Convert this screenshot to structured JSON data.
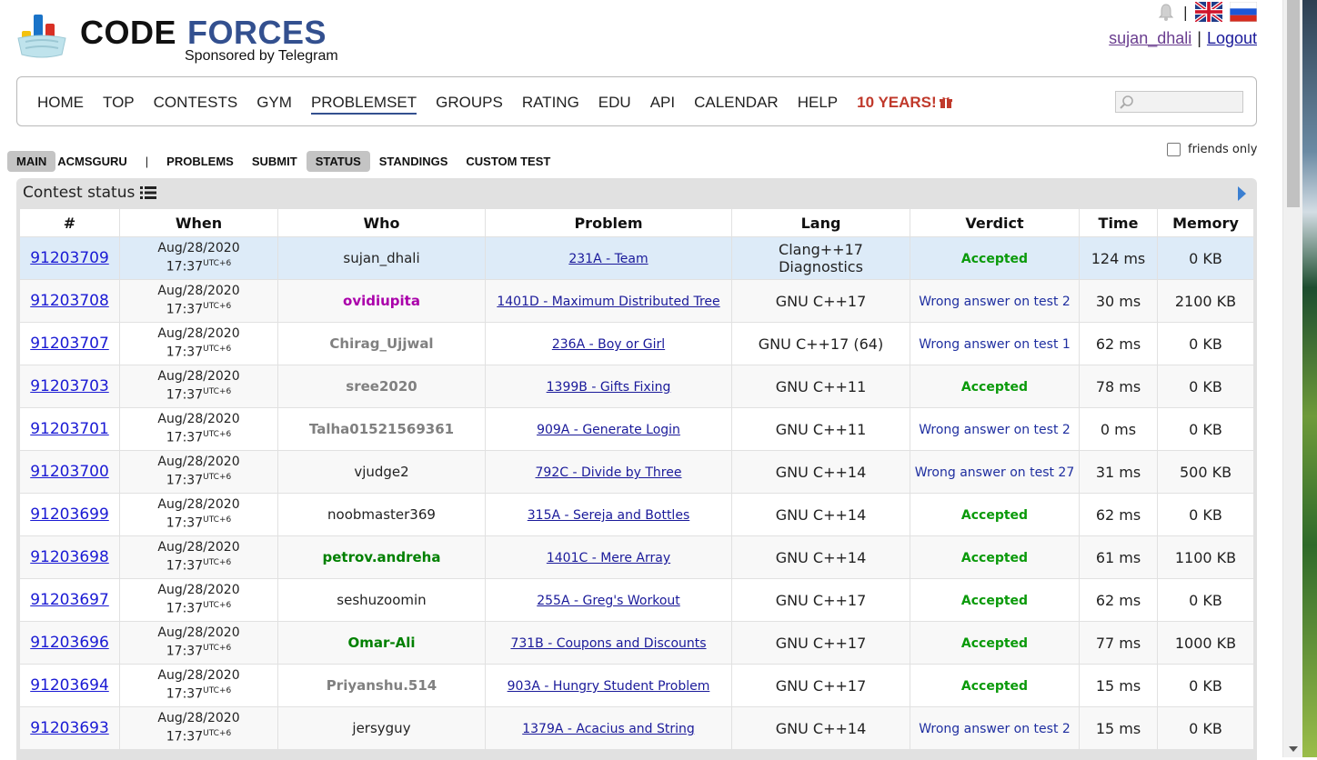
{
  "brand": {
    "word_code": "CODE",
    "word_forces": "FORCES",
    "sponsor": "Sponsored by Telegram"
  },
  "header": {
    "separator": "|",
    "username": "sujan_dhali",
    "logout": "Logout",
    "icons": [
      "bell-icon",
      "english-flag-icon",
      "russian-flag-icon"
    ]
  },
  "menu": {
    "items": [
      "HOME",
      "TOP",
      "CONTESTS",
      "GYM",
      "PROBLEMSET",
      "GROUPS",
      "RATING",
      "EDU",
      "API",
      "CALENDAR",
      "HELP"
    ],
    "special": "10 YEARS!",
    "active": "PROBLEMSET"
  },
  "submenu": {
    "items": [
      "MAIN",
      "ACMSGURU",
      "|",
      "PROBLEMS",
      "SUBMIT",
      "STATUS",
      "STANDINGS",
      "CUSTOM TEST"
    ],
    "friends_only": "friends only"
  },
  "panel": {
    "title": "Contest status"
  },
  "table": {
    "headers": [
      "#",
      "When",
      "Who",
      "Problem",
      "Lang",
      "Verdict",
      "Time",
      "Memory"
    ],
    "utc": "UTC+6",
    "rows": [
      {
        "id": "91203709",
        "date": "Aug/28/2020",
        "time": "17:37",
        "who": "sujan_dhali",
        "who_color": "#222222",
        "who_bold": false,
        "problem": "231A - Team",
        "lang": "Clang++17 Diagnostics",
        "verdict": "Accepted",
        "verdict_type": "ac",
        "run_time": "124 ms",
        "memory": "0 KB"
      },
      {
        "id": "91203708",
        "date": "Aug/28/2020",
        "time": "17:37",
        "who": "ovidiupita",
        "who_color": "#aa00aa",
        "who_bold": true,
        "problem": "1401D - Maximum Distributed Tree",
        "lang": "GNU C++17",
        "verdict": "Wrong answer on test 2",
        "verdict_type": "wa",
        "run_time": "30 ms",
        "memory": "2100 KB"
      },
      {
        "id": "91203707",
        "date": "Aug/28/2020",
        "time": "17:37",
        "who": "Chirag_Ujjwal",
        "who_color": "#808080",
        "who_bold": true,
        "problem": "236A - Boy or Girl",
        "lang": "GNU C++17 (64)",
        "verdict": "Wrong answer on test 1",
        "verdict_type": "wa",
        "run_time": "62 ms",
        "memory": "0 KB"
      },
      {
        "id": "91203703",
        "date": "Aug/28/2020",
        "time": "17:37",
        "who": "sree2020",
        "who_color": "#808080",
        "who_bold": true,
        "problem": "1399B - Gifts Fixing",
        "lang": "GNU C++11",
        "verdict": "Accepted",
        "verdict_type": "ac",
        "run_time": "78 ms",
        "memory": "0 KB"
      },
      {
        "id": "91203701",
        "date": "Aug/28/2020",
        "time": "17:37",
        "who": "Talha01521569361",
        "who_color": "#808080",
        "who_bold": true,
        "problem": "909A - Generate Login",
        "lang": "GNU C++11",
        "verdict": "Wrong answer on test 2",
        "verdict_type": "wa",
        "run_time": "0 ms",
        "memory": "0 KB"
      },
      {
        "id": "91203700",
        "date": "Aug/28/2020",
        "time": "17:37",
        "who": "vjudge2",
        "who_color": "#222222",
        "who_bold": false,
        "problem": "792C - Divide by Three",
        "lang": "GNU C++14",
        "verdict": "Wrong answer on test 27",
        "verdict_type": "wa",
        "run_time": "31 ms",
        "memory": "500 KB"
      },
      {
        "id": "91203699",
        "date": "Aug/28/2020",
        "time": "17:37",
        "who": "noobmaster369",
        "who_color": "#222222",
        "who_bold": false,
        "problem": "315A - Sereja and Bottles",
        "lang": "GNU C++14",
        "verdict": "Accepted",
        "verdict_type": "ac",
        "run_time": "62 ms",
        "memory": "0 KB"
      },
      {
        "id": "91203698",
        "date": "Aug/28/2020",
        "time": "17:37",
        "who": "petrov.andreha",
        "who_color": "#008000",
        "who_bold": true,
        "problem": "1401C - Mere Array",
        "lang": "GNU C++14",
        "verdict": "Accepted",
        "verdict_type": "ac",
        "run_time": "61 ms",
        "memory": "1100 KB"
      },
      {
        "id": "91203697",
        "date": "Aug/28/2020",
        "time": "17:37",
        "who": "seshuzoomin",
        "who_color": "#222222",
        "who_bold": false,
        "problem": "255A - Greg's Workout",
        "lang": "GNU C++17",
        "verdict": "Accepted",
        "verdict_type": "ac",
        "run_time": "62 ms",
        "memory": "0 KB"
      },
      {
        "id": "91203696",
        "date": "Aug/28/2020",
        "time": "17:37",
        "who": "Omar-Ali",
        "who_color": "#008000",
        "who_bold": true,
        "problem": "731B - Coupons and Discounts",
        "lang": "GNU C++17",
        "verdict": "Accepted",
        "verdict_type": "ac",
        "run_time": "77 ms",
        "memory": "1000 KB"
      },
      {
        "id": "91203694",
        "date": "Aug/28/2020",
        "time": "17:37",
        "who": "Priyanshu.514",
        "who_color": "#808080",
        "who_bold": true,
        "problem": "903A - Hungry Student Problem",
        "lang": "GNU C++17",
        "verdict": "Accepted",
        "verdict_type": "ac",
        "run_time": "15 ms",
        "memory": "0 KB"
      },
      {
        "id": "91203693",
        "date": "Aug/28/2020",
        "time": "17:37",
        "who": "jersyguy",
        "who_color": "#222222",
        "who_bold": false,
        "problem": "1379A - Acacius and String",
        "lang": "GNU C++14",
        "verdict": "Wrong answer on test 2",
        "verdict_type": "wa",
        "run_time": "15 ms",
        "memory": "0 KB"
      }
    ]
  }
}
